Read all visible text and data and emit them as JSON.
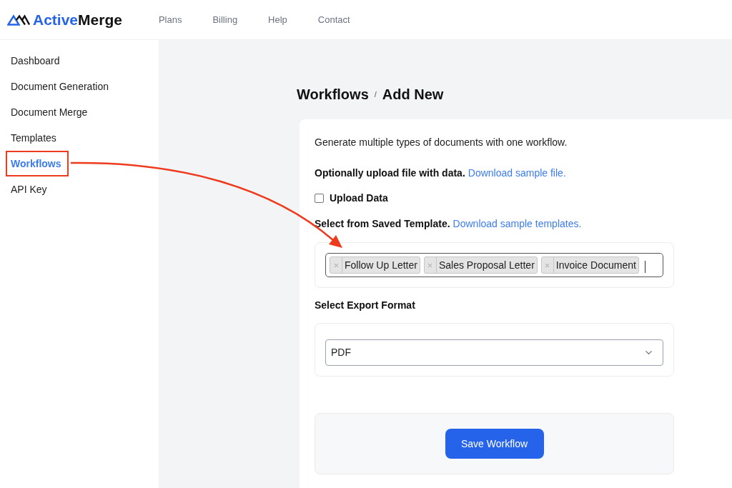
{
  "header": {
    "brand": {
      "parts": [
        "Active",
        "Merge"
      ]
    },
    "nav": [
      "Plans",
      "Billing",
      "Help",
      "Contact"
    ]
  },
  "sidebar": {
    "items": [
      {
        "label": "Dashboard",
        "selected": false,
        "highlighted": false
      },
      {
        "label": "Document Generation",
        "selected": false,
        "highlighted": false
      },
      {
        "label": "Document Merge",
        "selected": false,
        "highlighted": false
      },
      {
        "label": "Templates",
        "selected": false,
        "highlighted": false
      },
      {
        "label": "Workflows",
        "selected": true,
        "highlighted": true
      },
      {
        "label": "API Key",
        "selected": false,
        "highlighted": false
      }
    ]
  },
  "breadcrumb": {
    "items": [
      "Workflows",
      "Add New"
    ],
    "separator": "/"
  },
  "form": {
    "intro": "Generate multiple types of documents with one workflow.",
    "upload": {
      "label": "Optionally upload file with data.",
      "link": "Download sample file."
    },
    "upload_checkbox": {
      "label": "Upload Data",
      "checked": false
    },
    "templates": {
      "label": "Select from Saved Template.",
      "link": "Download sample templates.",
      "selected": [
        {
          "label": "Follow Up Letter"
        },
        {
          "label": "Sales Proposal Letter"
        },
        {
          "label": "Invoice Document"
        }
      ]
    },
    "export": {
      "label": "Select Export Format",
      "value": "PDF"
    },
    "save_button": "Save Workflow"
  }
}
